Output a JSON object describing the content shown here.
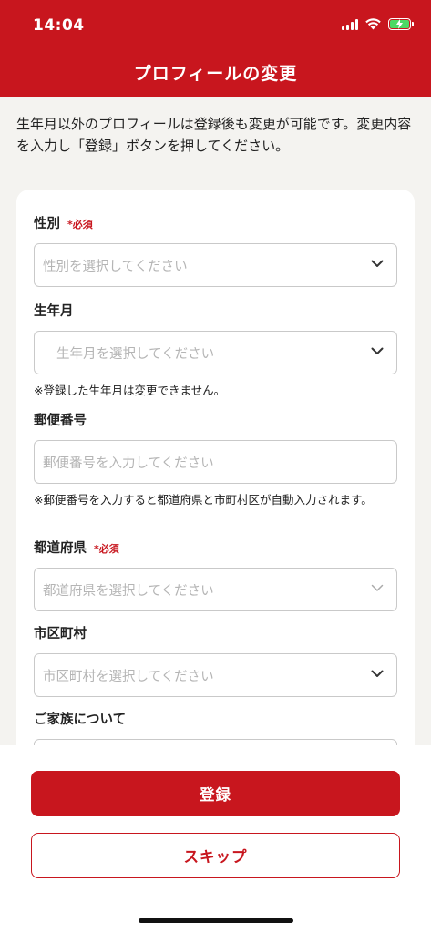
{
  "status_bar": {
    "time": "14:04",
    "battery_charging": true,
    "icons": [
      "signal-icon",
      "wifi-icon",
      "battery-icon"
    ]
  },
  "header": {
    "title": "プロフィールの変更"
  },
  "intro": "生年月以外のプロフィールは登録後も変更が可能です。変更内容を入力し「登録」ボタンを押してください。",
  "form": {
    "gender": {
      "label": "性別",
      "required": "*必須",
      "placeholder": "性別を選択してください"
    },
    "birth": {
      "label": "生年月",
      "placeholder": "生年月を選択してください",
      "note": "※登録した生年月は変更できません。"
    },
    "postal": {
      "label": "郵便番号",
      "placeholder": "郵便番号を入力してください",
      "note": "※郵便番号を入力すると都道府県と市町村区が自動入力されます。"
    },
    "prefecture": {
      "label": "都道府県",
      "required": "*必須",
      "placeholder": "都道府県を選択してください"
    },
    "city": {
      "label": "市区町村",
      "placeholder": "市区町村を選択してください"
    },
    "family": {
      "label": "ご家族について"
    }
  },
  "actions": {
    "register": "登録",
    "skip": "スキップ"
  },
  "colors": {
    "brand": "#c8161e",
    "background": "#f4f3f0",
    "placeholder": "#b5b5b5"
  }
}
